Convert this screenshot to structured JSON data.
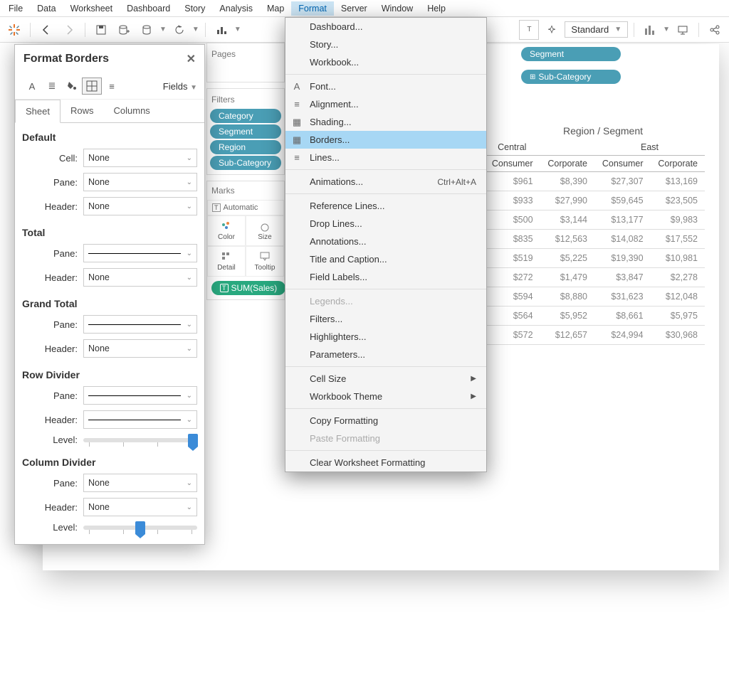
{
  "menubar": [
    "File",
    "Data",
    "Worksheet",
    "Dashboard",
    "Story",
    "Analysis",
    "Map",
    "Format",
    "Server",
    "Window",
    "Help"
  ],
  "menubar_active": "Format",
  "toolbar": {
    "standard": "Standard"
  },
  "shelves": {
    "columns_label": "",
    "rows_label": "",
    "col_pills": [
      "Segment"
    ],
    "row_pills": [
      "Sub-Category"
    ]
  },
  "sidebar": {
    "pages": "Pages",
    "filters": "Filters",
    "marks": "Marks",
    "filter_pills": [
      "Category",
      "Segment",
      "Region",
      "Sub-Category"
    ],
    "auto": "Automatic",
    "color": "Color",
    "size": "Size",
    "detail": "Detail",
    "tooltip": "Tooltip",
    "text_pill": "SUM(Sales)"
  },
  "viz": {
    "title": "Region / Segment",
    "regions": [
      "Central",
      "East"
    ],
    "segments": [
      "Consumer",
      "Corporate",
      "Consumer",
      "Corporate"
    ],
    "rows": [
      [
        "$961",
        "$8,390",
        "$27,307",
        "$13,169"
      ],
      [
        "$933",
        "$27,990",
        "$59,645",
        "$23,505"
      ],
      [
        "$500",
        "$3,144",
        "$13,177",
        "$9,983"
      ],
      [
        "$835",
        "$12,563",
        "$14,082",
        "$17,552"
      ],
      [
        "$519",
        "$5,225",
        "$19,390",
        "$10,981"
      ],
      [
        "$272",
        "$1,479",
        "$3,847",
        "$2,278"
      ],
      [
        "$594",
        "$8,880",
        "$31,623",
        "$12,048"
      ],
      [
        "$564",
        "$5,952",
        "$8,661",
        "$5,975"
      ],
      [
        "$572",
        "$12,657",
        "$24,994",
        "$30,968"
      ]
    ]
  },
  "context_menu": [
    {
      "t": "Dashboard..."
    },
    {
      "t": "Story..."
    },
    {
      "t": "Workbook..."
    },
    {
      "sep": 1
    },
    {
      "t": "Font...",
      "i": "A"
    },
    {
      "t": "Alignment...",
      "i": "≡"
    },
    {
      "t": "Shading...",
      "i": "▦"
    },
    {
      "t": "Borders...",
      "i": "▦",
      "hl": 1
    },
    {
      "t": "Lines...",
      "i": "≡"
    },
    {
      "sep": 1
    },
    {
      "t": "Animations...",
      "shc": "Ctrl+Alt+A"
    },
    {
      "sep": 1
    },
    {
      "t": "Reference Lines..."
    },
    {
      "t": "Drop Lines..."
    },
    {
      "t": "Annotations..."
    },
    {
      "t": "Title and Caption..."
    },
    {
      "t": "Field Labels..."
    },
    {
      "sep": 1
    },
    {
      "t": "Legends...",
      "dis": 1
    },
    {
      "t": "Filters..."
    },
    {
      "t": "Highlighters..."
    },
    {
      "t": "Parameters..."
    },
    {
      "sep": 1
    },
    {
      "t": "Cell Size",
      "sub": 1
    },
    {
      "t": "Workbook Theme",
      "sub": 1
    },
    {
      "sep": 1
    },
    {
      "t": "Copy Formatting"
    },
    {
      "t": "Paste Formatting",
      "dis": 1
    },
    {
      "sep": 1
    },
    {
      "t": "Clear Worksheet Formatting"
    }
  ],
  "format": {
    "title": "Format Borders",
    "fields": "Fields",
    "tabs": [
      "Sheet",
      "Rows",
      "Columns"
    ],
    "active_tab": "Sheet",
    "default": "Default",
    "cell": "Cell:",
    "pane": "Pane:",
    "header": "Header:",
    "total": "Total",
    "grand": "Grand Total",
    "rowdiv": "Row Divider",
    "coldiv": "Column Divider",
    "level": "Level:",
    "none": "None",
    "row_level_pct": 96,
    "col_level_pct": 50
  }
}
